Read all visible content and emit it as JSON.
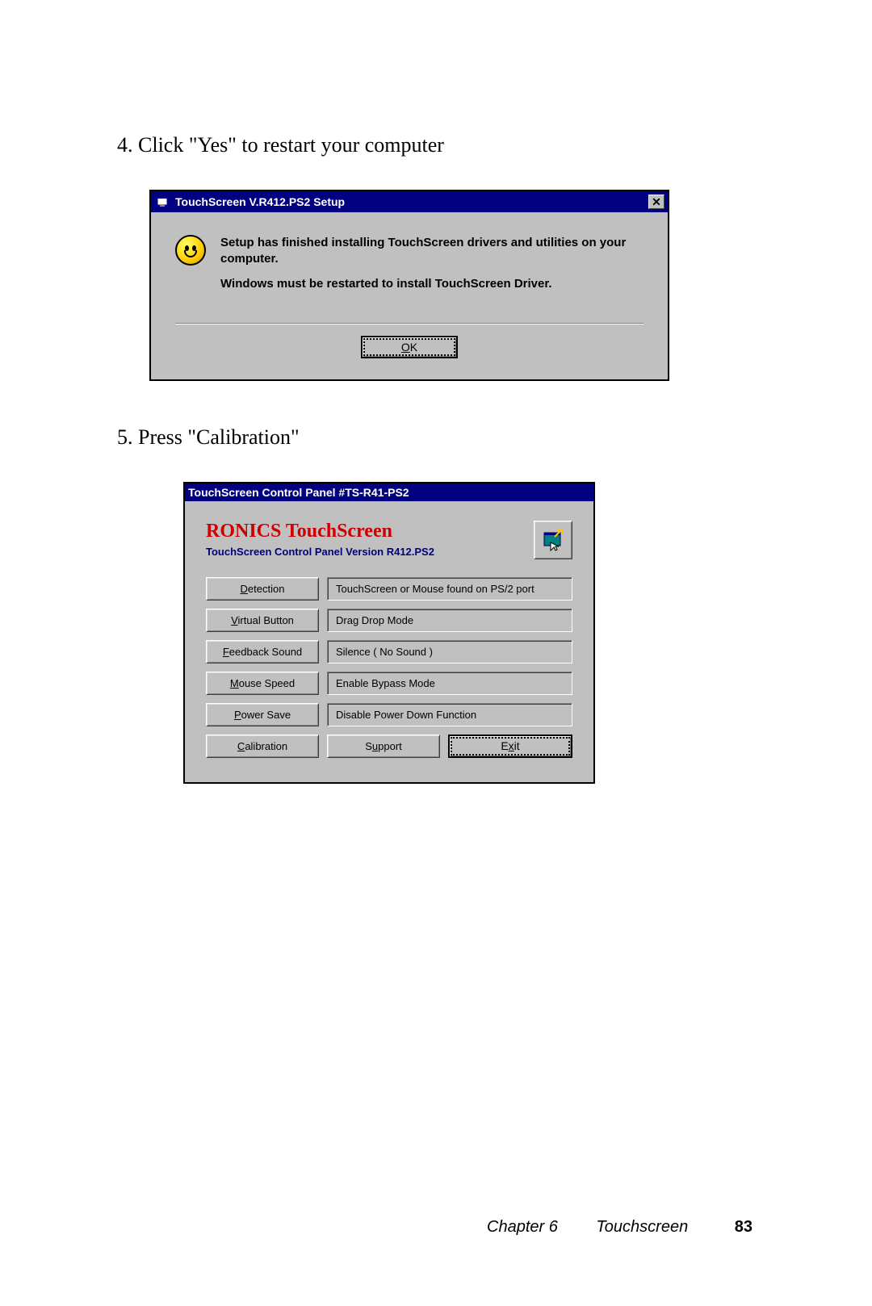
{
  "steps": {
    "s4": "4. Click \"Yes\" to restart your computer",
    "s5": "5. Press \"Calibration\""
  },
  "dialog1": {
    "title": "TouchScreen V.R412.PS2 Setup",
    "msg1": "Setup has finished installing TouchScreen drivers and utilities on your computer.",
    "msg2": "Windows must be restarted to install TouchScreen Driver.",
    "ok_u": "O",
    "ok_rest": "K"
  },
  "dialog2": {
    "title": "TouchScreen Control Panel #TS-R41-PS2",
    "brand": "RONICS TouchScreen",
    "brand_sub": "TouchScreen Control Panel Version R412.PS2",
    "rows": [
      {
        "btn_u": "D",
        "btn_rest": "etection",
        "val": "TouchScreen or Mouse found on PS/2 port"
      },
      {
        "btn_u": "V",
        "btn_rest": "irtual Button",
        "val": "Drag Drop Mode"
      },
      {
        "btn_u": "F",
        "btn_rest": "eedback Sound",
        "val": "Silence ( No Sound )"
      },
      {
        "btn_u": "M",
        "btn_rest": "ouse Speed",
        "val": "Enable Bypass Mode"
      },
      {
        "btn_u": "P",
        "btn_rest": "ower Save",
        "val": "Disable Power Down Function"
      }
    ],
    "bottom": {
      "cal_u": "C",
      "cal_rest": "alibration",
      "sup_pre": "S",
      "sup_u": "u",
      "sup_rest": "pport",
      "exit_pre": "E",
      "exit_u": "x",
      "exit_rest": "it"
    }
  },
  "footer": {
    "chapter": "Chapter 6",
    "title": "Touchscreen",
    "page": "83"
  }
}
